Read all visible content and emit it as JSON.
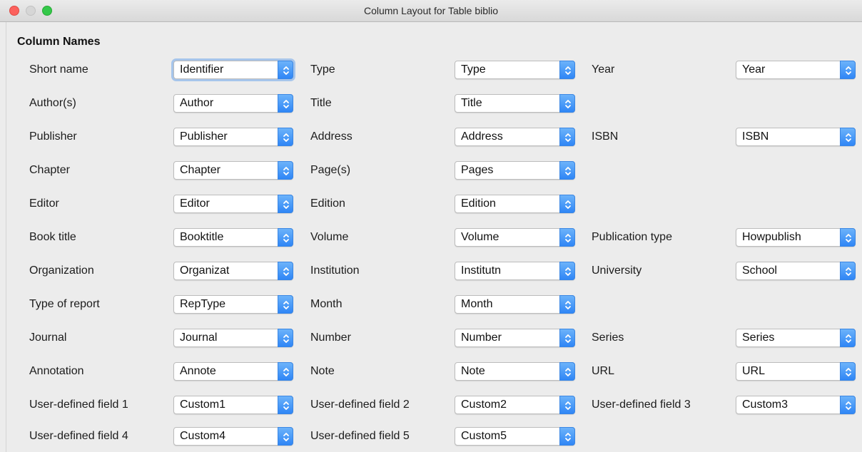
{
  "window": {
    "title": "Column Layout for Table biblio"
  },
  "section": {
    "title": "Column Names"
  },
  "fields": [
    {
      "label": "Short name",
      "value": "Identifier"
    },
    {
      "label": "Type",
      "value": "Type"
    },
    {
      "label": "Year",
      "value": "Year"
    },
    {
      "label": "Author(s)",
      "value": "Author"
    },
    {
      "label": "Title",
      "value": "Title"
    },
    {
      "label": "Publisher",
      "value": "Publisher"
    },
    {
      "label": "Address",
      "value": "Address"
    },
    {
      "label": "ISBN",
      "value": "ISBN"
    },
    {
      "label": "Chapter",
      "value": "Chapter"
    },
    {
      "label": "Page(s)",
      "value": "Pages"
    },
    {
      "label": "Editor",
      "value": "Editor"
    },
    {
      "label": "Edition",
      "value": "Edition"
    },
    {
      "label": "Book title",
      "value": "Booktitle"
    },
    {
      "label": "Volume",
      "value": "Volume"
    },
    {
      "label": "Publication type",
      "value": "Howpublish"
    },
    {
      "label": "Organization",
      "value": "Organizat"
    },
    {
      "label": "Institution",
      "value": "Institutn"
    },
    {
      "label": "University",
      "value": "School"
    },
    {
      "label": "Type of report",
      "value": "RepType"
    },
    {
      "label": "Month",
      "value": "Month"
    },
    {
      "label": "Journal",
      "value": "Journal"
    },
    {
      "label": "Number",
      "value": "Number"
    },
    {
      "label": "Series",
      "value": "Series"
    },
    {
      "label": "Annotation",
      "value": "Annote"
    },
    {
      "label": "Note",
      "value": "Note"
    },
    {
      "label": "URL",
      "value": "URL"
    },
    {
      "label": "User-defined field 1",
      "value": "Custom1"
    },
    {
      "label": "User-defined field 2",
      "value": "Custom2"
    },
    {
      "label": "User-defined field 3",
      "value": "Custom3"
    },
    {
      "label": "User-defined field 4",
      "value": "Custom4"
    },
    {
      "label": "User-defined field 5",
      "value": "Custom5"
    }
  ],
  "icons": {
    "combo_arrows": "up-down-chevron-icon"
  },
  "colors": {
    "accent": "#2f86f6",
    "close": "#fc615d",
    "maximize": "#34c84a"
  }
}
